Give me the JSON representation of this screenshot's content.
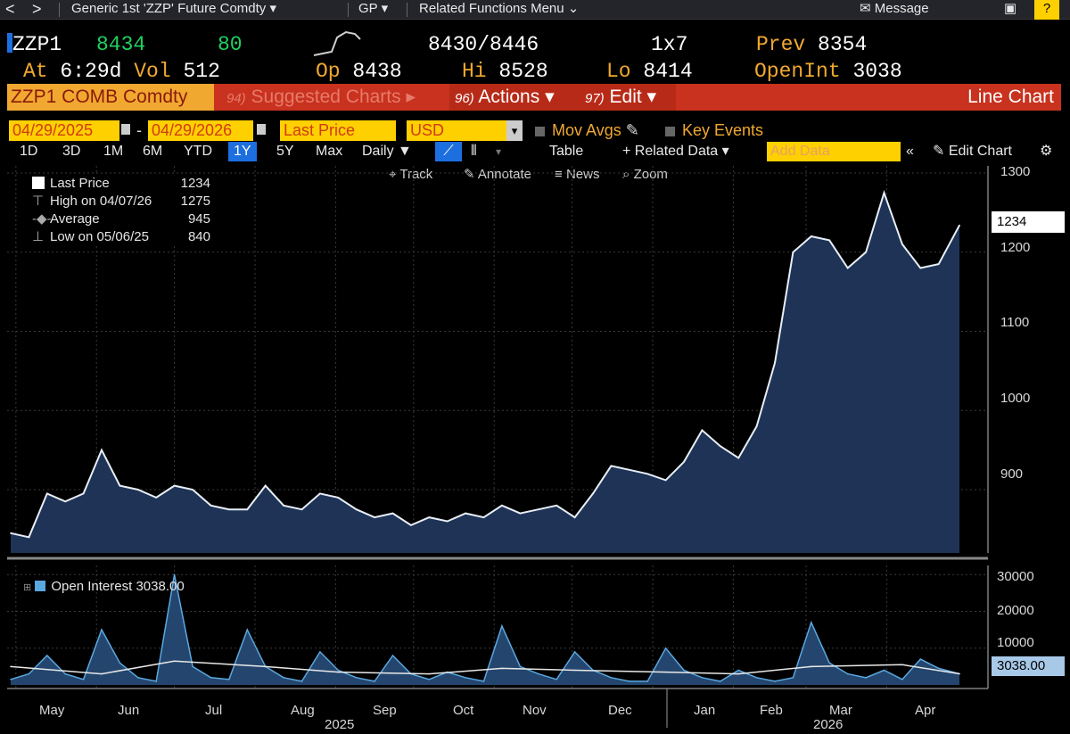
{
  "topbar": {
    "back": "<",
    "forward": ">",
    "security_menu": "Generic 1st 'ZZP' Future Comdty",
    "function_menu": "GP",
    "related_menu": "Related Functions Menu",
    "message": "Message"
  },
  "quote": {
    "ticker": "ZZP1",
    "last": "8434",
    "change": "80",
    "bid_ask": "8430/8446",
    "size": "1x7",
    "prev_label": "Prev",
    "prev": "8354",
    "at_label": "At",
    "time": "6:29d",
    "vol_label": "Vol",
    "volume": "512",
    "open_label": "Op",
    "open": "8438",
    "high_label": "Hi",
    "high": "8528",
    "low_label": "Lo",
    "low": "8414",
    "openint_label": "OpenInt",
    "openint": "3038"
  },
  "menubar": {
    "security": "ZZP1 COMB Comdty",
    "suggested_num": "94)",
    "suggested": "Suggested Charts",
    "actions_num": "96)",
    "actions": "Actions",
    "edit_num": "97)",
    "edit": "Edit",
    "chart_type": "Line Chart"
  },
  "controls": {
    "start_date": "04/29/2025",
    "dash": "-",
    "end_date": "04/29/2026",
    "field": "Last Price",
    "currency": "USD",
    "mov_avgs": "Mov Avgs",
    "key_events": "Key Events"
  },
  "toolbar": {
    "periods": [
      "1D",
      "3D",
      "1M",
      "6M",
      "YTD",
      "1Y",
      "5Y",
      "Max"
    ],
    "active_period": "1Y",
    "frequency": "Daily",
    "table": "Table",
    "related_data": "+ Related Data",
    "add_data_placeholder": "Add Data",
    "edit_chart": "Edit Chart",
    "track": "Track",
    "annotate": "Annotate",
    "news": "News",
    "zoom": "Zoom"
  },
  "legend": {
    "last_label": "Last Price",
    "last_value": "1234",
    "high_label": "High on 04/07/26",
    "high_value": "1275",
    "avg_label": "Average",
    "avg_value": "945",
    "low_label": "Low on 05/06/25",
    "low_value": "840"
  },
  "oi_legend": {
    "label": "Open Interest 3038.00"
  },
  "price_axis": {
    "ticks": [
      "1300",
      "1200",
      "1100",
      "1000",
      "900"
    ],
    "current": "1234"
  },
  "oi_axis": {
    "ticks": [
      "30000",
      "20000",
      "10000"
    ],
    "current": "3038.00"
  },
  "x_axis": {
    "months": [
      "May",
      "Jun",
      "Jul",
      "Aug",
      "Sep",
      "Oct",
      "Nov",
      "Dec",
      "Jan",
      "Feb",
      "Mar",
      "Apr"
    ],
    "years": [
      "2025",
      "2026"
    ]
  },
  "colors": {
    "accent_amber": "#f0a830",
    "change_green": "#20d060",
    "menu_red": "#c8321e",
    "highlight_yellow": "#ffd000",
    "active_blue": "#1d6fe0",
    "area_fill": "#1e3356",
    "oi_fill": "#5aa8e0"
  },
  "chart_data": [
    {
      "type": "area",
      "title": "",
      "series": [
        {
          "name": "Last Price",
          "x": [
            "2025-04-29",
            "2025-05-06",
            "2025-05-13",
            "2025-05-20",
            "2025-05-27",
            "2025-06-03",
            "2025-06-10",
            "2025-06-17",
            "2025-06-24",
            "2025-07-01",
            "2025-07-08",
            "2025-07-15",
            "2025-07-22",
            "2025-07-29",
            "2025-08-05",
            "2025-08-12",
            "2025-08-19",
            "2025-08-26",
            "2025-09-02",
            "2025-09-09",
            "2025-09-16",
            "2025-09-23",
            "2025-09-30",
            "2025-10-07",
            "2025-10-14",
            "2025-10-21",
            "2025-10-28",
            "2025-11-04",
            "2025-11-11",
            "2025-11-18",
            "2025-11-25",
            "2025-12-02",
            "2025-12-09",
            "2025-12-16",
            "2025-12-23",
            "2025-12-30",
            "2026-01-06",
            "2026-01-13",
            "2026-01-20",
            "2026-01-27",
            "2026-02-03",
            "2026-02-10",
            "2026-02-17",
            "2026-02-24",
            "2026-03-03",
            "2026-03-10",
            "2026-03-17",
            "2026-03-24",
            "2026-03-31",
            "2026-04-07",
            "2026-04-14",
            "2026-04-21",
            "2026-04-29"
          ],
          "values": [
            845,
            840,
            895,
            885,
            895,
            950,
            905,
            900,
            890,
            905,
            900,
            880,
            875,
            875,
            905,
            880,
            875,
            895,
            890,
            875,
            865,
            870,
            855,
            865,
            860,
            870,
            865,
            880,
            870,
            875,
            880,
            865,
            895,
            930,
            925,
            920,
            912,
            935,
            975,
            955,
            940,
            980,
            1060,
            1200,
            1220,
            1215,
            1180,
            1200,
            1275,
            1210,
            1180,
            1185,
            1234
          ],
          "ylim": [
            820,
            1300
          ]
        }
      ]
    },
    {
      "type": "area",
      "title": "",
      "series": [
        {
          "name": "Open Interest",
          "x": [
            "2025-04-29",
            "2025-05-06",
            "2025-05-13",
            "2025-05-20",
            "2025-05-27",
            "2025-06-03",
            "2025-06-10",
            "2025-06-17",
            "2025-06-24",
            "2025-07-01",
            "2025-07-08",
            "2025-07-15",
            "2025-07-22",
            "2025-07-29",
            "2025-08-05",
            "2025-08-12",
            "2025-08-19",
            "2025-08-26",
            "2025-09-02",
            "2025-09-09",
            "2025-09-16",
            "2025-09-23",
            "2025-09-30",
            "2025-10-07",
            "2025-10-14",
            "2025-10-21",
            "2025-10-28",
            "2025-11-04",
            "2025-11-11",
            "2025-11-18",
            "2025-11-25",
            "2025-12-02",
            "2025-12-09",
            "2025-12-16",
            "2025-12-23",
            "2025-12-30",
            "2026-01-06",
            "2026-01-13",
            "2026-01-20",
            "2026-01-27",
            "2026-02-03",
            "2026-02-10",
            "2026-02-17",
            "2026-02-24",
            "2026-03-03",
            "2026-03-10",
            "2026-03-17",
            "2026-03-24",
            "2026-03-31",
            "2026-04-07",
            "2026-04-14",
            "2026-04-21",
            "2026-04-29"
          ],
          "values": [
            1500,
            3000,
            8000,
            3000,
            1500,
            15000,
            6000,
            2000,
            1000,
            30000,
            5000,
            2000,
            1500,
            15000,
            5000,
            2000,
            1000,
            9000,
            4000,
            2000,
            1000,
            8000,
            3000,
            1500,
            3500,
            2000,
            1000,
            16000,
            5000,
            3000,
            1500,
            9000,
            4000,
            2000,
            1000,
            1000,
            10000,
            4000,
            2000,
            1000,
            4000,
            2000,
            1000,
            2000,
            17000,
            6000,
            3000,
            2000,
            4000,
            1500,
            7000,
            4500,
            3038
          ],
          "ylim": [
            0,
            32000
          ]
        },
        {
          "name": "",
          "x": [
            "2025-04-29",
            "2025-06-03",
            "2025-07-01",
            "2025-08-05",
            "2025-09-02",
            "2025-10-07",
            "2025-11-04",
            "2025-12-02",
            "2026-01-06",
            "2026-02-03",
            "2026-03-03",
            "2026-04-07",
            "2026-04-29"
          ],
          "values": [
            5000,
            3000,
            6500,
            5000,
            3500,
            3000,
            4500,
            4000,
            3500,
            3000,
            5000,
            5500,
            3038
          ]
        }
      ]
    }
  ]
}
